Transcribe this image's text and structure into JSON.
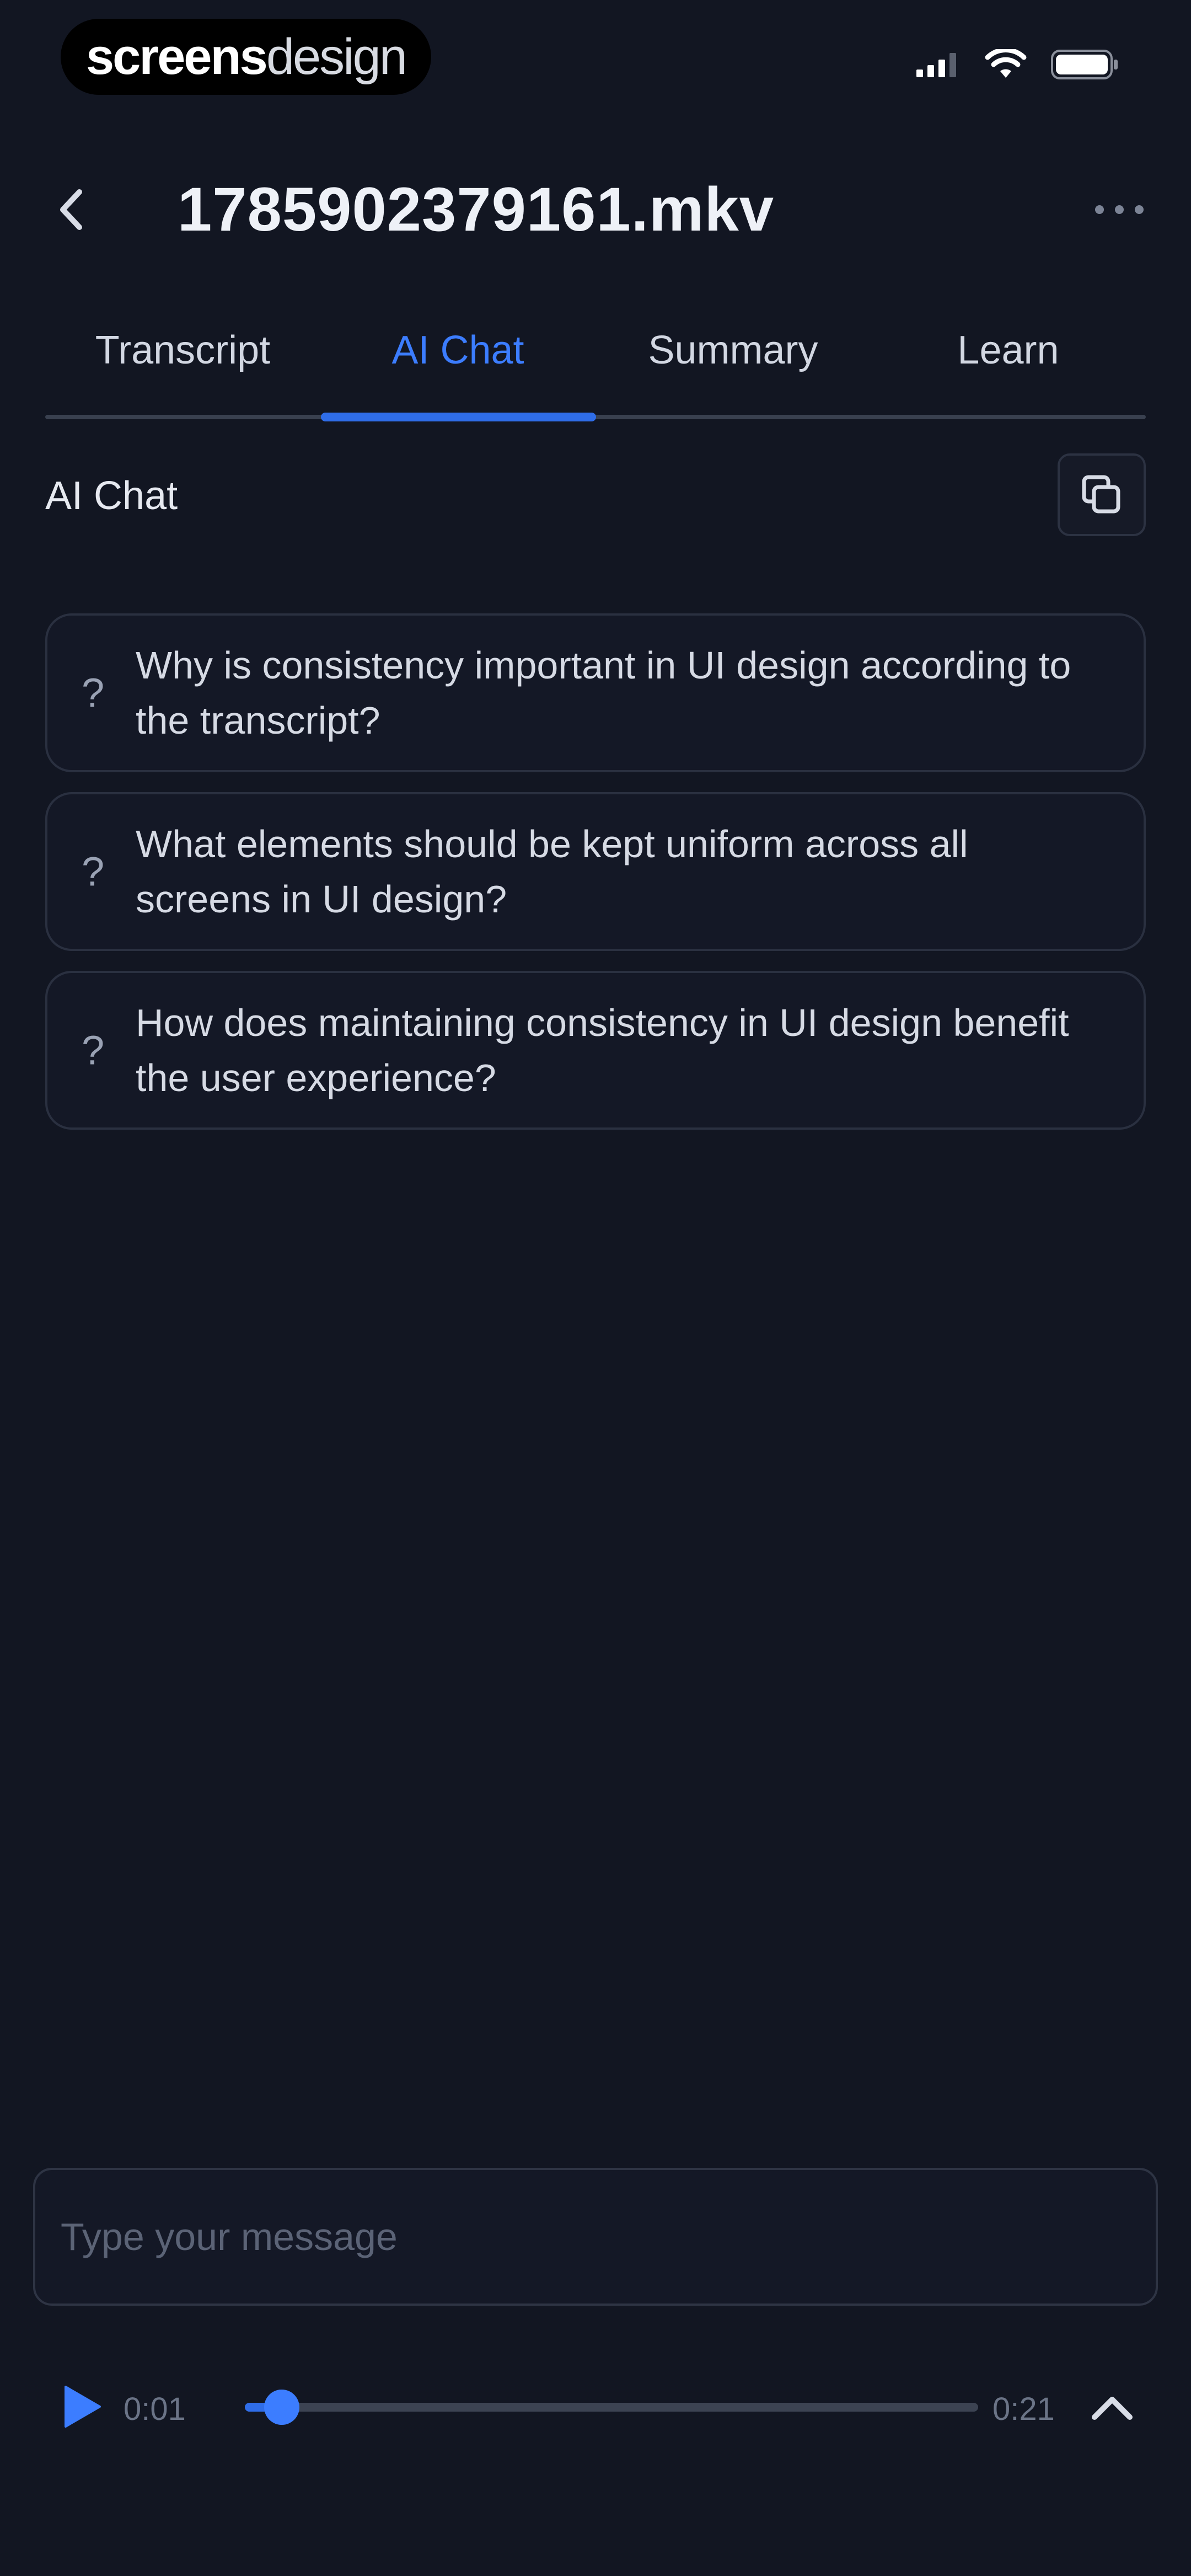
{
  "watermark": {
    "part1": "screens",
    "part2": "design"
  },
  "status_bar": {
    "icons": [
      "signal-icon",
      "wifi-icon",
      "battery-icon"
    ]
  },
  "header": {
    "back_icon": "chevron-left-icon",
    "title": "1785902379161.mkv",
    "more_icon": "more-horizontal-icon"
  },
  "tabs": [
    {
      "label": "Transcript",
      "active": false
    },
    {
      "label": "AI Chat",
      "active": true
    },
    {
      "label": "Summary",
      "active": false
    },
    {
      "label": "Learn",
      "active": false
    }
  ],
  "section": {
    "title": "AI Chat",
    "copy_icon": "copy-icon"
  },
  "suggestions": [
    {
      "icon": "?",
      "text": "Why is consistency important in UI design according to the transcript?"
    },
    {
      "icon": "?",
      "text": "What elements should be kept uniform across all screens in UI design?"
    },
    {
      "icon": "?",
      "text": "How does maintaining consistency in UI design benefit the user experience?"
    }
  ],
  "composer": {
    "placeholder": "Type your message",
    "value": ""
  },
  "player": {
    "play_icon": "play-icon",
    "current_time": "0:01",
    "total_time": "0:21",
    "progress_fraction": 0.05,
    "expand_icon": "chevron-up-icon"
  },
  "colors": {
    "background": "#121622",
    "accent": "#3c7dff",
    "card_border": "#2a3040",
    "text_primary": "#e9edf5",
    "text_muted": "#6b7487"
  }
}
